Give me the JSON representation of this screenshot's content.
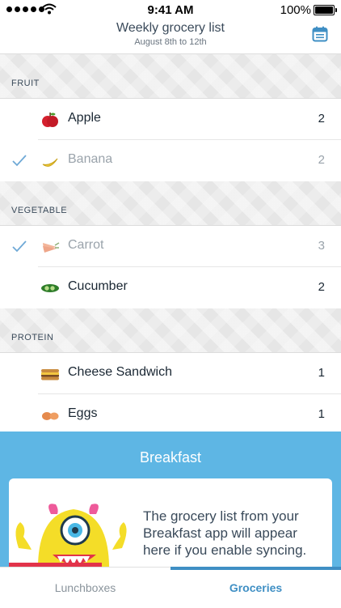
{
  "status_bar": {
    "time": "9:41 AM",
    "battery": "100%",
    "signal_icon": "signal-dots-icon",
    "wifi_icon": "wifi-icon",
    "battery_icon": "battery-icon"
  },
  "header": {
    "title": "Weekly grocery list",
    "subtitle": "August 8th to 12th",
    "calendar_icon": "calendar-icon"
  },
  "sections": [
    {
      "label": "FRUIT",
      "items": [
        {
          "name": "Apple",
          "qty": "2",
          "checked": false,
          "icon": "apple-icon"
        },
        {
          "name": "Banana",
          "qty": "2",
          "checked": true,
          "icon": "banana-icon"
        }
      ]
    },
    {
      "label": "VEGETABLE",
      "items": [
        {
          "name": "Carrot",
          "qty": "3",
          "checked": true,
          "icon": "carrot-icon"
        },
        {
          "name": "Cucumber",
          "qty": "2",
          "checked": false,
          "icon": "cucumber-icon"
        }
      ]
    },
    {
      "label": "PROTEIN",
      "items": [
        {
          "name": "Cheese Sandwich",
          "qty": "1",
          "checked": false,
          "icon": "sandwich-icon"
        },
        {
          "name": "Eggs",
          "qty": "1",
          "checked": false,
          "icon": "eggs-icon"
        }
      ]
    }
  ],
  "promo": {
    "title": "Breakfast",
    "message": "The grocery list from your Breakfast app will appear here if you enable syncing.",
    "mascot_icon": "monster-mascot-icon"
  },
  "tabs": [
    {
      "label": "Lunchboxes",
      "active": false
    },
    {
      "label": "Groceries",
      "active": true
    }
  ],
  "colors": {
    "accent": "#3f8fc4",
    "promo_bg": "#5eb6e4",
    "check": "#6fa9d6",
    "muted_text": "#9aa3ab"
  }
}
